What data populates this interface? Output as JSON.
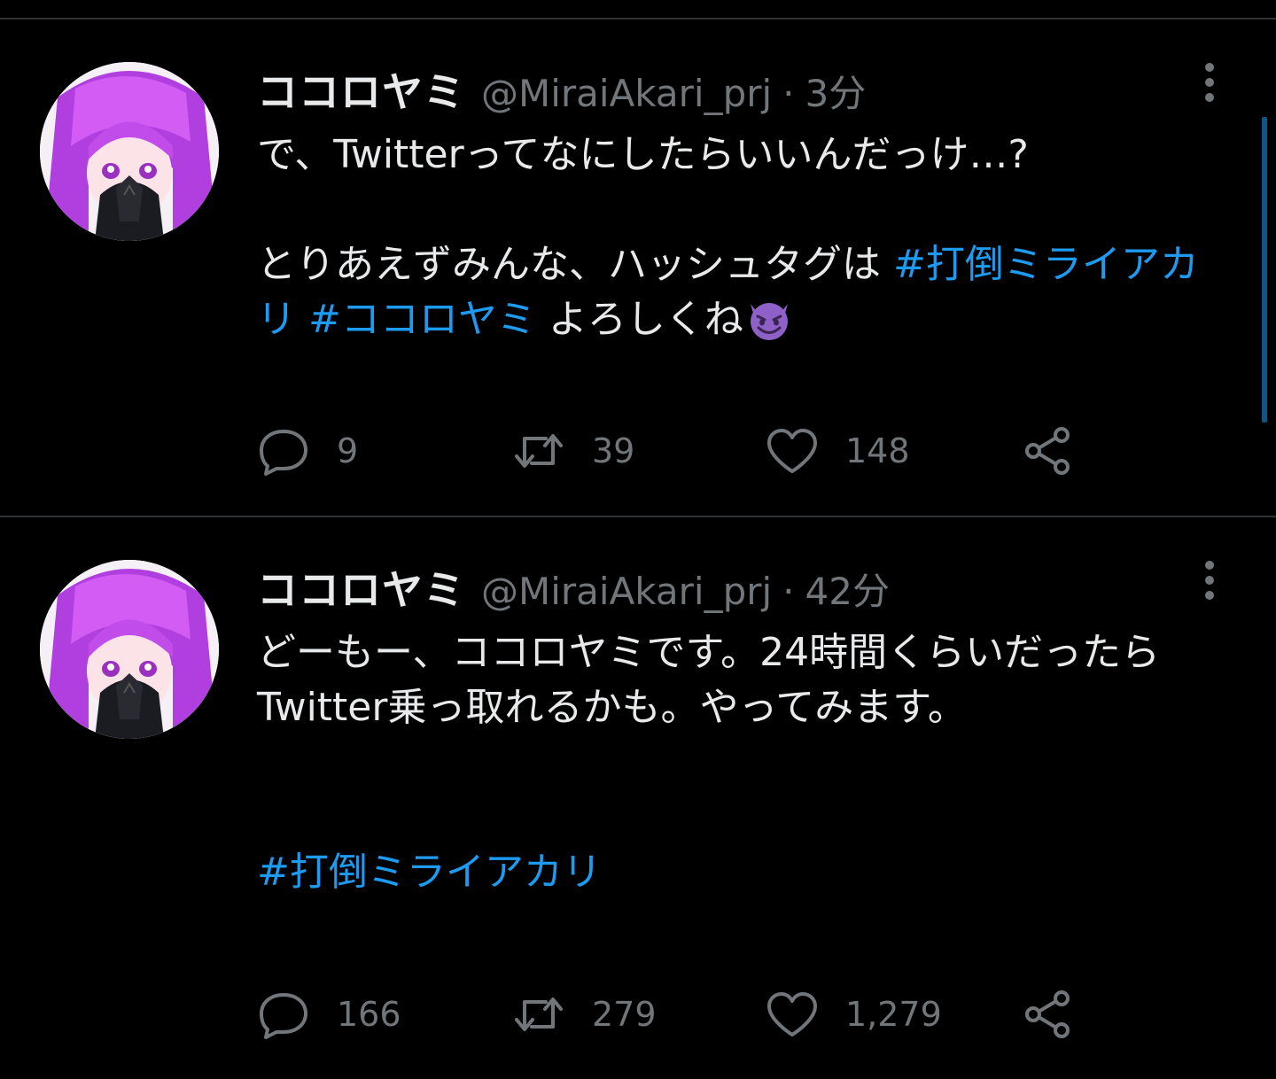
{
  "colors": {
    "background": "#000000",
    "text_primary": "#e7e9ea",
    "text_secondary": "#71767b",
    "hashtag": "#1d9bf0",
    "divider": "#2f3336"
  },
  "tweets": [
    {
      "author": {
        "name": "ココロヤミ",
        "handle": "@MiraiAkari_prj",
        "separator": "·",
        "time": "3分"
      },
      "body": {
        "line1": "で、Twitterってなにしたらいいんだっけ…?",
        "line2_text": "とりあえずみんな、ハッシュタグは ",
        "hashtag1": "#打倒ミライアカリ",
        "space": " ",
        "hashtag2": "#ココロヤミ",
        "line2_end": " よろしくね",
        "emoji": "smiling-devil-emoji"
      },
      "stats": {
        "replies": "9",
        "retweets": "39",
        "likes": "148"
      }
    },
    {
      "author": {
        "name": "ココロヤミ",
        "handle": "@MiraiAkari_prj",
        "separator": "·",
        "time": "42分"
      },
      "body": {
        "paragraph": "どーもー、ココロヤミです。24時間くらいだったらTwitter乗っ取れるかも。やってみます。",
        "hashtag": "#打倒ミライアカリ"
      },
      "stats": {
        "replies": "166",
        "retweets": "279",
        "likes": "1,279"
      }
    }
  ],
  "icons": {
    "more": "more-vertical-icon",
    "reply": "reply-icon",
    "retweet": "retweet-icon",
    "like": "heart-icon",
    "share": "share-icon"
  }
}
